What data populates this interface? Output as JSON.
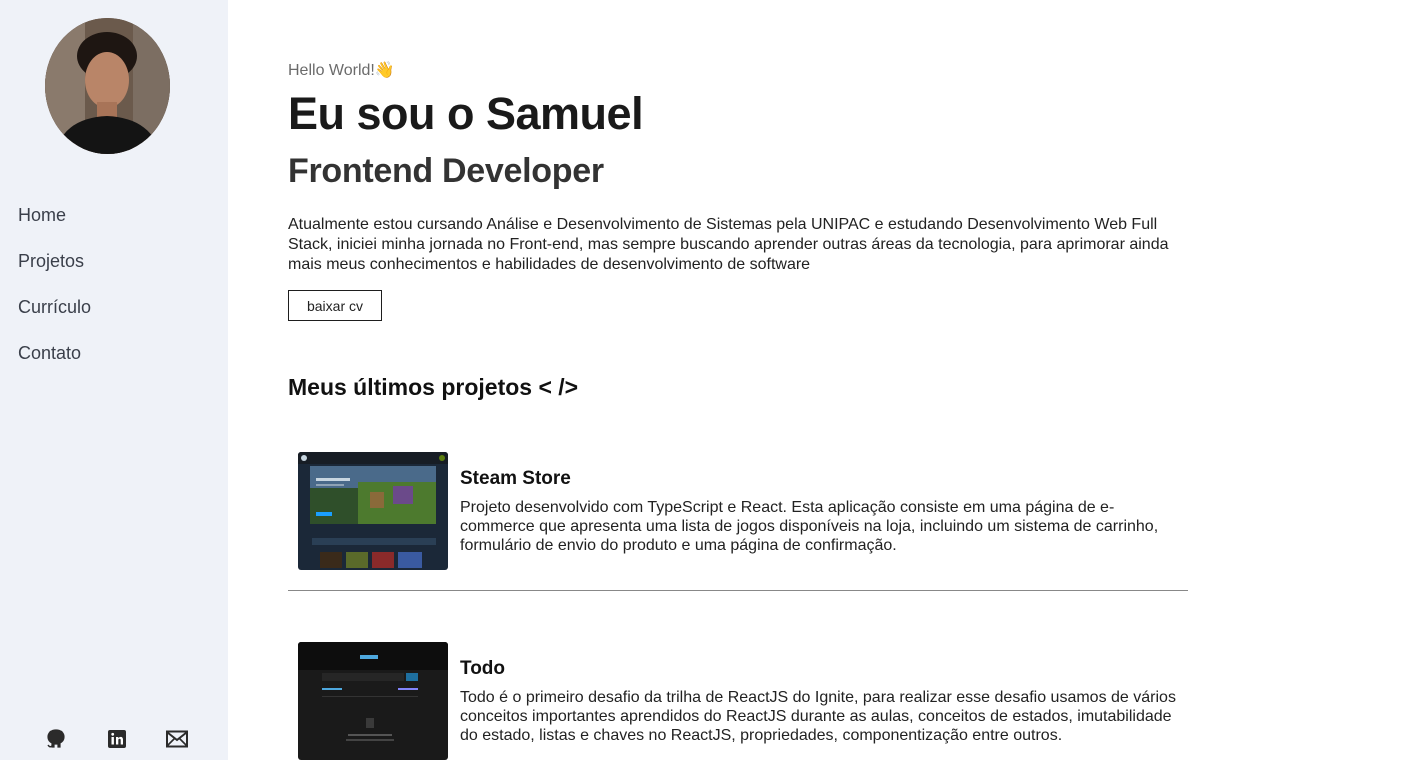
{
  "sidebar": {
    "nav": [
      {
        "label": "Home"
      },
      {
        "label": "Projetos"
      },
      {
        "label": "Currículo"
      },
      {
        "label": "Contato"
      }
    ],
    "socials": [
      "github-icon",
      "linkedin-icon",
      "mail-icon"
    ],
    "background": "#eff2f8"
  },
  "hero": {
    "greeting": "Hello World!👋",
    "name": "Eu sou o Samuel",
    "role": "Frontend Developer",
    "bio": "Atualmente estou cursando Análise e Desenvolvimento de Sistemas pela UNIPAC e estudando Desenvolvimento Web Full Stack, iniciei minha jornada no Front-end, mas sempre buscando aprender outras áreas da tecnologia, para aprimorar ainda mais meus conhecimentos e habilidades de desenvolvimento de software",
    "cv_button": "baixar cv"
  },
  "projects": {
    "section_title": "Meus últimos projetos < />",
    "items": [
      {
        "title": "Steam Store",
        "description": "Projeto desenvolvido com TypeScript e React. Esta aplicação consiste em uma página de e-commerce que apresenta uma lista de jogos disponíveis na loja, incluindo um sistema de carrinho, formulário de envio do produto e uma página de confirmação."
      },
      {
        "title": "Todo",
        "description": "Todo é o primeiro desafio da trilha de ReactJS do Ignite, para realizar esse desafio usamos de vários conceitos importantes aprendidos do ReactJS durante as aulas, conceitos de estados, imutabilidade do estado, listas e chaves no ReactJS, propriedades, componentização entre outros."
      }
    ]
  }
}
